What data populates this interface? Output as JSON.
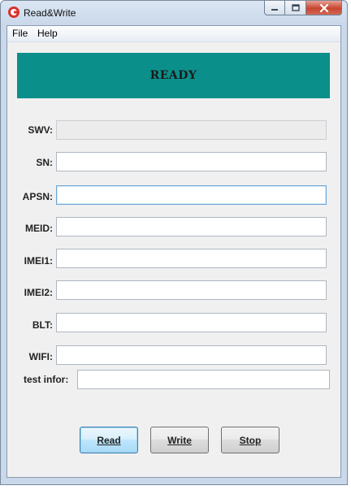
{
  "window": {
    "title": "Read&Write",
    "icons": {
      "app": "app-logo-icon",
      "minimize": "minimize-icon",
      "maximize": "maximize-icon",
      "close": "close-icon"
    }
  },
  "menu": {
    "items": [
      "File",
      "Help"
    ]
  },
  "status": {
    "text": "READY",
    "color": "#0b8f8b"
  },
  "fields": [
    {
      "label": "SWV:",
      "value": ""
    },
    {
      "label": "SN:",
      "value": ""
    },
    {
      "label": "APSN:",
      "value": ""
    },
    {
      "label": "MEID:",
      "value": ""
    },
    {
      "label": "IMEI1:",
      "value": ""
    },
    {
      "label": "IMEI2:",
      "value": ""
    },
    {
      "label": "BLT:",
      "value": ""
    },
    {
      "label": "WIFI:",
      "value": ""
    },
    {
      "label": "test infor:",
      "value": ""
    }
  ],
  "buttons": {
    "read": "Read",
    "write": "Write",
    "stop": "Stop"
  }
}
